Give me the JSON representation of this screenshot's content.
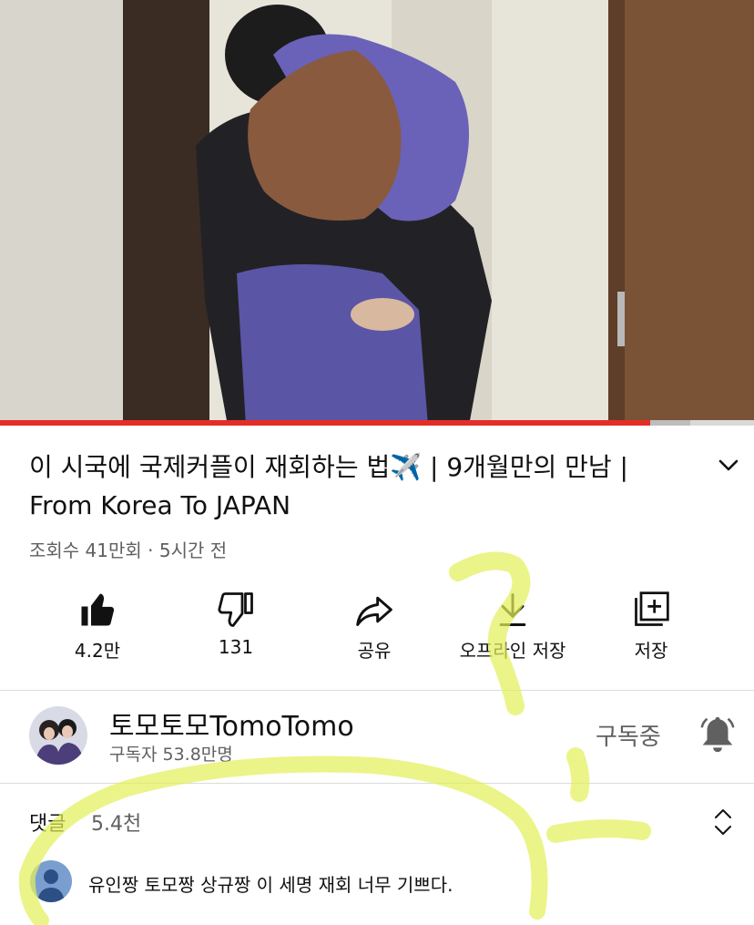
{
  "video": {
    "progress": 0.862,
    "buffered": 0.915,
    "colors": {
      "played": "#e52d27",
      "buffered": "#bdbdbd",
      "track": "#d9d9d9"
    }
  },
  "title": {
    "text_part1": "이 시국에 국제커플이 재회하는 법",
    "emoji": "✈️",
    "text_part2": " | 9개월만의 만남 | From Korea To JAPAN"
  },
  "meta": {
    "views": "조회수 41만회",
    "separator": " · ",
    "time": "5시간 전"
  },
  "actions": [
    {
      "label": "4.2만",
      "icon": "like-icon"
    },
    {
      "label": "131",
      "icon": "dislike-icon"
    },
    {
      "label": "공유",
      "icon": "share-icon"
    },
    {
      "label": "오프라인 저장",
      "icon": "download-icon"
    },
    {
      "label": "저장",
      "icon": "save-playlist-icon"
    }
  ],
  "channel": {
    "name": "토모토모TomoTomo",
    "subscribers": "구독자 53.8만명",
    "subscribed_label": "구독중",
    "icon": "bell-icon"
  },
  "comments": {
    "label": "댓글",
    "count": "5.4천",
    "top_comment": "유인짱 토모짱 상규짱 이 세명 재회 너무 기쁘다."
  },
  "highlight_color": "#e3f05a"
}
